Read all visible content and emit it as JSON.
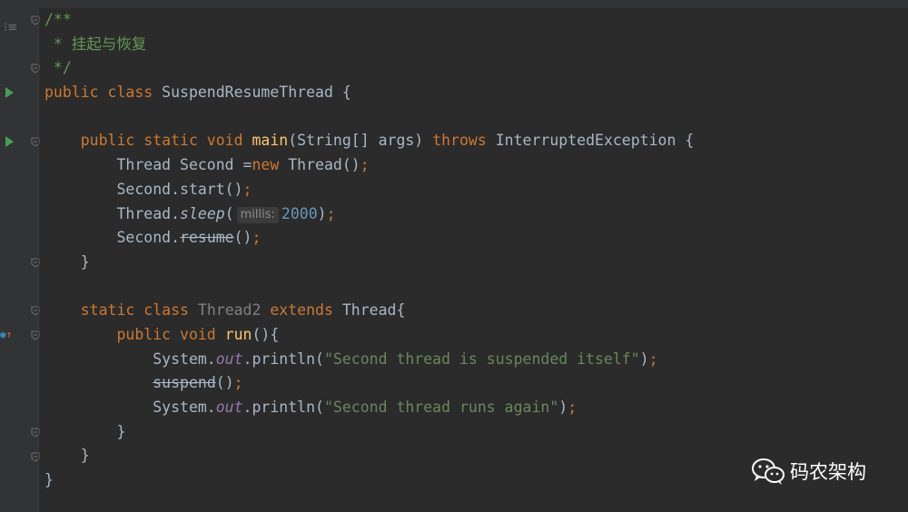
{
  "editor": {
    "lines": [
      [
        {
          "t": "/**",
          "c": "cm"
        }
      ],
      [
        {
          "t": " * 挂起与恢复",
          "c": "cm"
        }
      ],
      [
        {
          "t": " */",
          "c": "cm"
        }
      ],
      [
        {
          "t": "public class ",
          "c": "kw"
        },
        {
          "t": "SuspendResumeThread {",
          "c": ""
        }
      ],
      [
        {
          "t": "",
          "c": ""
        }
      ],
      [
        {
          "t": "    public static void ",
          "c": "kw"
        },
        {
          "t": "main",
          "c": "fn"
        },
        {
          "t": "(String[] args) ",
          "c": ""
        },
        {
          "t": "throws ",
          "c": "kw"
        },
        {
          "t": "InterruptedException {",
          "c": ""
        }
      ],
      [
        {
          "t": "        Thread Second =",
          "c": ""
        },
        {
          "t": "new ",
          "c": "kw"
        },
        {
          "t": "Thread()",
          "c": ""
        },
        {
          "t": ";",
          "c": "kw"
        }
      ],
      [
        {
          "t": "        Second.start()",
          "c": ""
        },
        {
          "t": ";",
          "c": "kw"
        }
      ],
      [
        {
          "t": "        Thread.",
          "c": ""
        },
        {
          "t": "sleep",
          "c": "itw"
        },
        {
          "t": "(",
          "c": ""
        },
        {
          "t": "millis:",
          "c": "hint"
        },
        {
          "t": "2000",
          "c": "nm"
        },
        {
          "t": ")",
          "c": ""
        },
        {
          "t": ";",
          "c": "kw"
        }
      ],
      [
        {
          "t": "        Second.",
          "c": ""
        },
        {
          "t": "resume",
          "c": "strike"
        },
        {
          "t": "()",
          "c": ""
        },
        {
          "t": ";",
          "c": "kw"
        }
      ],
      [
        {
          "t": "    }",
          "c": ""
        }
      ],
      [
        {
          "t": "",
          "c": ""
        }
      ],
      [
        {
          "t": "    static class ",
          "c": "kw"
        },
        {
          "t": "Thread2 ",
          "c": "dim"
        },
        {
          "t": "extends ",
          "c": "kw"
        },
        {
          "t": "Thread{",
          "c": ""
        }
      ],
      [
        {
          "t": "        public void ",
          "c": "kw"
        },
        {
          "t": "run",
          "c": "fn"
        },
        {
          "t": "(){",
          "c": ""
        }
      ],
      [
        {
          "t": "            System.",
          "c": ""
        },
        {
          "t": "out",
          "c": "it"
        },
        {
          "t": ".println(",
          "c": ""
        },
        {
          "t": "\"Second thread is suspended itself\"",
          "c": "st"
        },
        {
          "t": ")",
          "c": ""
        },
        {
          "t": ";",
          "c": "kw"
        }
      ],
      [
        {
          "t": "            ",
          "c": ""
        },
        {
          "t": "suspend",
          "c": "strike"
        },
        {
          "t": "()",
          "c": ""
        },
        {
          "t": ";",
          "c": "kw"
        }
      ],
      [
        {
          "t": "            System.",
          "c": ""
        },
        {
          "t": "out",
          "c": "it"
        },
        {
          "t": ".println(",
          "c": ""
        },
        {
          "t": "\"Second thread runs again\"",
          "c": "st"
        },
        {
          "t": ")",
          "c": ""
        },
        {
          "t": ";",
          "c": "kw"
        }
      ],
      [
        {
          "t": "        }",
          "c": ""
        }
      ],
      [
        {
          "t": "    }",
          "c": ""
        }
      ],
      [
        {
          "t": "}",
          "c": ""
        }
      ]
    ]
  },
  "gutter": {
    "structure_icon": "structure-icon",
    "run_icon_lines": [
      3,
      5
    ],
    "implementing_icon_line": 13,
    "fold_lines": [
      0,
      2,
      5,
      10,
      12,
      13,
      17,
      18
    ]
  },
  "watermark": {
    "text": "码农架构",
    "icon": "wechat-icon"
  }
}
